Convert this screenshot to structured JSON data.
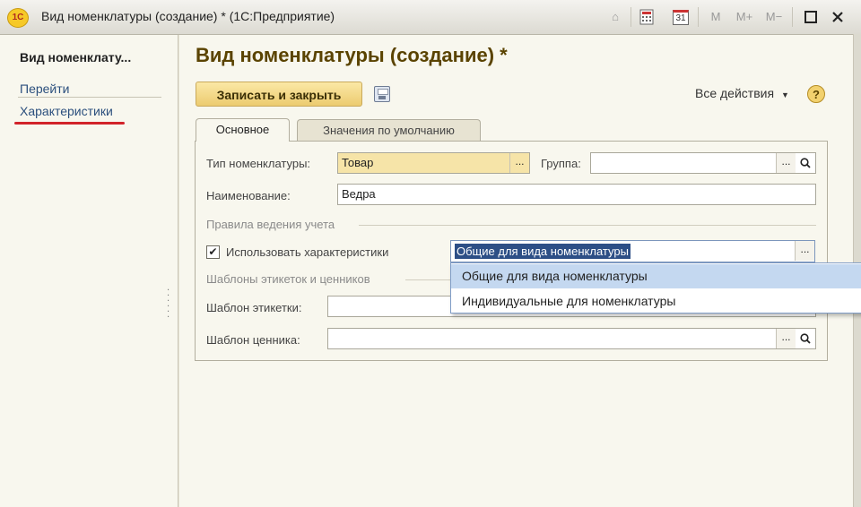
{
  "window": {
    "title": "Вид номенклатуры  (создание) * (1С:Предприятие)",
    "logo_text": "1С",
    "toolbar_icons": [
      "home-icon",
      "calculator-icon",
      "calendar-icon"
    ],
    "calendar_day": "31",
    "memory_buttons": [
      "M",
      "M+",
      "M−"
    ],
    "controls": [
      "maximize",
      "close"
    ]
  },
  "sidebar": {
    "title": "Вид номенклату...",
    "items": [
      {
        "label": "Перейти",
        "type": "section"
      },
      {
        "label": "Характеристики",
        "type": "link",
        "highlighted": true
      }
    ]
  },
  "form": {
    "title": "Вид номенклатуры  (создание) *",
    "save_button": "Записать и закрыть",
    "all_actions": "Все действия",
    "help": "?",
    "tabs": [
      {
        "label": "Основное",
        "active": true
      },
      {
        "label": "Значения по умолчанию",
        "active": false
      }
    ],
    "fields": {
      "type": {
        "label": "Тип номенклатуры:",
        "value": "Товар"
      },
      "group": {
        "label": "Группа:",
        "value": ""
      },
      "name": {
        "label": "Наименование:",
        "value": "Ведра"
      },
      "use_characteristics": {
        "label": "Использовать характеристики",
        "checked": true,
        "value": "Общие для вида номенклатуры"
      },
      "label_template": {
        "label": "Шаблон этикетки:",
        "value": ""
      },
      "price_template": {
        "label": "Шаблон ценника:",
        "value": ""
      }
    },
    "sections": {
      "accounting": "Правила ведения учета",
      "templates": "Шаблоны этикеток и ценников"
    },
    "dropdown": {
      "options": [
        "Общие для вида номенклатуры",
        "Индивидуальные для номенклатуры"
      ],
      "highlighted_index": 0
    },
    "colors": {
      "title": "#5a4300",
      "accent_button": "#eccb70",
      "selection": "#2d4f86",
      "hover": "#c4d8f0",
      "annotation_underline": "#d2232a"
    }
  }
}
